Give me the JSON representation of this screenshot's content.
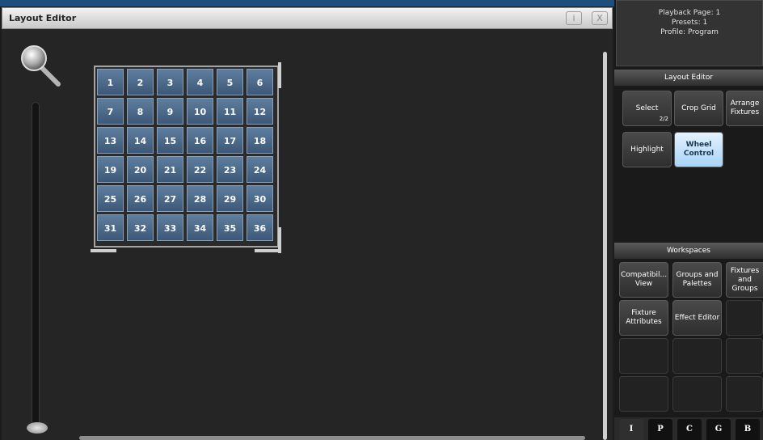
{
  "window": {
    "title": "Layout Editor",
    "info_label": "i",
    "close_label": "X"
  },
  "grid": {
    "cells": [
      "1",
      "2",
      "3",
      "4",
      "5",
      "6",
      "7",
      "8",
      "9",
      "10",
      "11",
      "12",
      "13",
      "14",
      "15",
      "16",
      "17",
      "18",
      "19",
      "20",
      "21",
      "22",
      "23",
      "24",
      "25",
      "26",
      "27",
      "28",
      "29",
      "30",
      "31",
      "32",
      "33",
      "34",
      "35",
      "36"
    ]
  },
  "status": {
    "lines": [
      "Playback Page: 1",
      "Presets: 1",
      "Profile: Program"
    ]
  },
  "layout_editor": {
    "header": "Layout Editor",
    "buttons": [
      {
        "label": "Select",
        "sub": "2/2",
        "active": false
      },
      {
        "label": "Crop Grid",
        "sub": "",
        "active": false
      },
      {
        "label": "Arrange Fixtures",
        "sub": "",
        "active": false
      },
      {
        "label": "Highlight",
        "sub": "",
        "active": false
      },
      {
        "label": "Wheel Control",
        "sub": "",
        "active": true
      }
    ]
  },
  "workspaces": {
    "header": "Workspaces",
    "buttons": [
      "Compatibil... View",
      "Groups and Palettes",
      "Fixtures and Groups",
      "Fixture Attributes",
      "Effect Editor"
    ]
  },
  "tabs": [
    "I",
    "P",
    "C",
    "G",
    "B"
  ],
  "icons": {
    "zoom": "magnifier-icon"
  },
  "colors": {
    "title_bar_accent": "#1e4f7a",
    "cell_fill": "#4e6d8e",
    "active_button": "#bfe0fb"
  }
}
